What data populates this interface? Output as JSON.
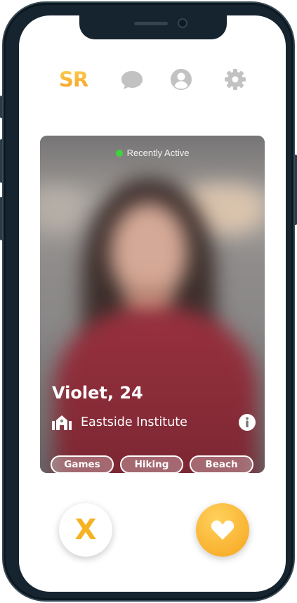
{
  "nav": {
    "logo": "SR",
    "icons": [
      "chat-bubble-icon",
      "profile-icon",
      "gear-icon"
    ],
    "icon_color": "#bdbdbd",
    "logo_color": "#f7b42c"
  },
  "profile": {
    "status": "Recently Active",
    "status_color": "#3cd63a",
    "name_age": "Violet, 24",
    "school": "Eastside Institute",
    "tags": [
      "Games",
      "Hiking",
      "Beach"
    ]
  },
  "actions": {
    "dislike_label": "X",
    "accent": "#f6a51e"
  }
}
